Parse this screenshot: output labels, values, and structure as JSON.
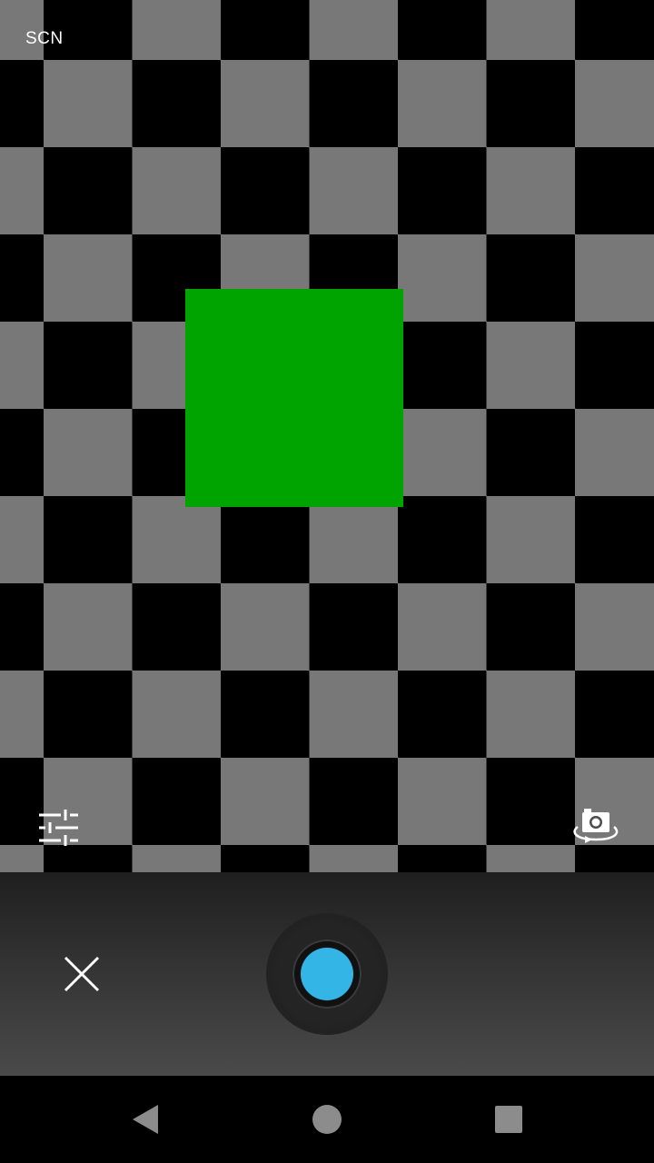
{
  "viewfinder": {
    "scene_mode_label": "SCN",
    "checker_light_color": "#787878",
    "checker_dark_color": "#000000",
    "subject_color": "#00a400"
  },
  "icons": {
    "settings": "sliders-icon",
    "switch_camera": "switch-camera-icon",
    "close": "close-icon",
    "back": "back-icon",
    "home": "home-icon",
    "recents": "recents-icon"
  },
  "controls": {
    "shutter_color": "#33b5e5"
  }
}
